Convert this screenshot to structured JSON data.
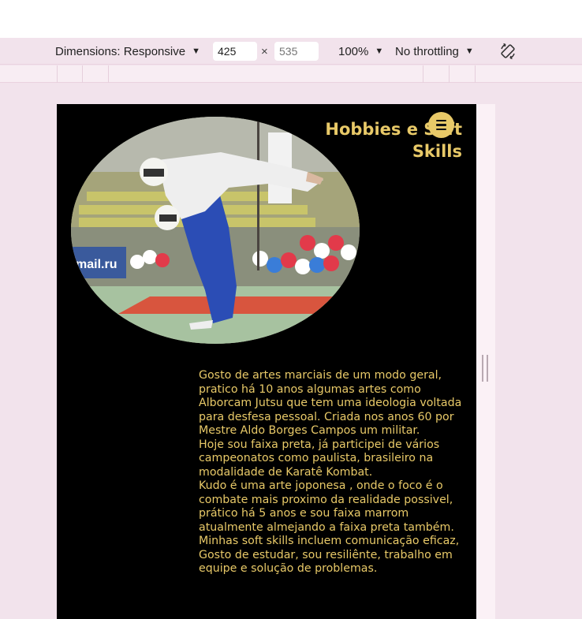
{
  "devtools": {
    "dimensions_label": "Dimensions: Responsive",
    "width_value": "425",
    "height_placeholder": "535",
    "times_sign": "×",
    "zoom_label": "100%",
    "throttling_label": "No throttling",
    "caret_glyph": "▼"
  },
  "page": {
    "title": "Hobbies e Soft Skills",
    "bio_paragraphs": [
      "Gosto de artes marciais de um modo geral, pratico há 10 anos algumas artes como Alborcam Jutsu que tem uma ideologia voltada para desfesa pessoal. Criada nos anos 60 por Mestre Aldo Borges Campos um militar.",
      "Hoje sou faixa preta, já participei de vários campeonatos como paulista, brasileiro na modalidade de Karatê Kombat.",
      "Kudo é uma arte joponesa , onde o foco é o combate mais proximo da realidade possivel, prático há 5 anos e sou faixa marrom atualmente almejando a faixa preta também.",
      "Minhas soft skills incluem comunicação eficaz, Gosto de estudar, sou resiliênte, trabalho em equipe e solução de problemas."
    ],
    "photo_banner_text": "mail.ru"
  },
  "colors": {
    "accent_gold": "#e8c968",
    "page_background": "#000000",
    "devtools_background": "#f2e3ec"
  }
}
